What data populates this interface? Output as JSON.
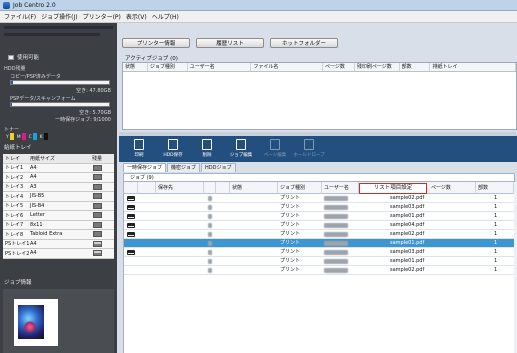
{
  "window": {
    "title": "Job Centro 2.0"
  },
  "menu": [
    "ファイル(F)",
    "ジョブ操作(J)",
    "プリンター(P)",
    "表示(V)",
    "ヘルプ(H)"
  ],
  "left": {
    "status": "使用可能",
    "hdd_title": "HDD残量",
    "copy_data_label": "コピー/PSP済みデータ",
    "copy_free": "空き: 47.80GB",
    "copy_fill_pct": 2,
    "psp_label": "PSPデータ/スキャンフォーム",
    "psp_free": "空き: 5.70GB",
    "psp_fill_pct": 1,
    "temp_label": "一時保存ジョブ: 9/1000",
    "toner_title": "トナー",
    "toner": [
      {
        "label": "Y",
        "color": "#f2d31b"
      },
      {
        "label": "M",
        "color": "#e0188a"
      },
      {
        "label": "C",
        "color": "#15a3dd"
      },
      {
        "label": "K",
        "color": "#111111"
      }
    ],
    "tray_title": "給紙トレイ",
    "tray_headers": [
      "トレイ",
      "用紙サイズ",
      "残量"
    ],
    "trays": [
      {
        "tray": "トレイ1",
        "size": "A4",
        "level": "full"
      },
      {
        "tray": "トレイ2",
        "size": "A4",
        "level": "full"
      },
      {
        "tray": "トレイ3",
        "size": "A3",
        "level": "full"
      },
      {
        "tray": "トレイ4",
        "size": "JIS-B5",
        "level": "full"
      },
      {
        "tray": "トレイ5",
        "size": "JIS-B4",
        "level": "full"
      },
      {
        "tray": "トレイ6",
        "size": "Letter",
        "level": "full"
      },
      {
        "tray": "トレイ7",
        "size": "8x11",
        "level": "full"
      },
      {
        "tray": "トレイ8",
        "size": "Tabloid Extra",
        "level": "full"
      },
      {
        "tray": "PSトレイ1",
        "size": "A4",
        "level": "partial"
      },
      {
        "tray": "PSトレイ2",
        "size": "A4",
        "level": "partial"
      }
    ],
    "jobinfo_title": "ジョブ情報"
  },
  "toolbar1": [
    "プリンター情報",
    "履歴リスト",
    "ホットフォルダー"
  ],
  "active_jobs_label": "アクティブジョブ (0)",
  "active_headers": [
    "状態",
    "ジョブ種別",
    "ユーザー名",
    "ファイル名",
    "ページ数",
    "残印刷ページ数",
    "部数",
    "排紙トレイ"
  ],
  "toolbar2": [
    {
      "label": "印刷",
      "enabled": true
    },
    {
      "label": "HDD保存",
      "enabled": true
    },
    {
      "label": "削除",
      "enabled": true
    },
    {
      "label": "ジョブ編集",
      "enabled": true
    },
    {
      "label": "ページ編集",
      "enabled": false
    },
    {
      "label": "ホールドロープ",
      "enabled": false
    }
  ],
  "tabs": [
    "一時保存ジョブ",
    "機密ジョブ",
    "HDDジョブ"
  ],
  "jobs_count_label": "ジョブ (9)",
  "job_headers": [
    "保存先",
    "状態",
    "ジョブ種別",
    "ユーザー名",
    "リスト項目設定",
    "ページ数",
    "部数"
  ],
  "jobs": [
    {
      "icon": true,
      "type": "プリント",
      "file": "sample02.pdf",
      "copies": "1",
      "selected": false
    },
    {
      "icon": true,
      "type": "プリント",
      "file": "sample03.pdf",
      "copies": "1",
      "selected": false
    },
    {
      "icon": true,
      "type": "プリント",
      "file": "sample01.pdf",
      "copies": "1",
      "selected": false
    },
    {
      "icon": true,
      "type": "プリント",
      "file": "sample04.pdf",
      "copies": "1",
      "selected": false
    },
    {
      "icon": true,
      "type": "プリント",
      "file": "sample02.pdf",
      "copies": "1",
      "selected": false
    },
    {
      "icon": false,
      "type": "プリント",
      "file": "sample01.pdf",
      "copies": "1",
      "selected": true
    },
    {
      "icon": true,
      "type": "プリント",
      "file": "sample03.pdf",
      "copies": "1",
      "selected": false
    },
    {
      "icon": false,
      "type": "プリント",
      "file": "sample01.pdf",
      "copies": "1",
      "selected": false
    },
    {
      "icon": false,
      "type": "プリント",
      "file": "sample02.pdf",
      "copies": "1",
      "selected": false
    }
  ]
}
